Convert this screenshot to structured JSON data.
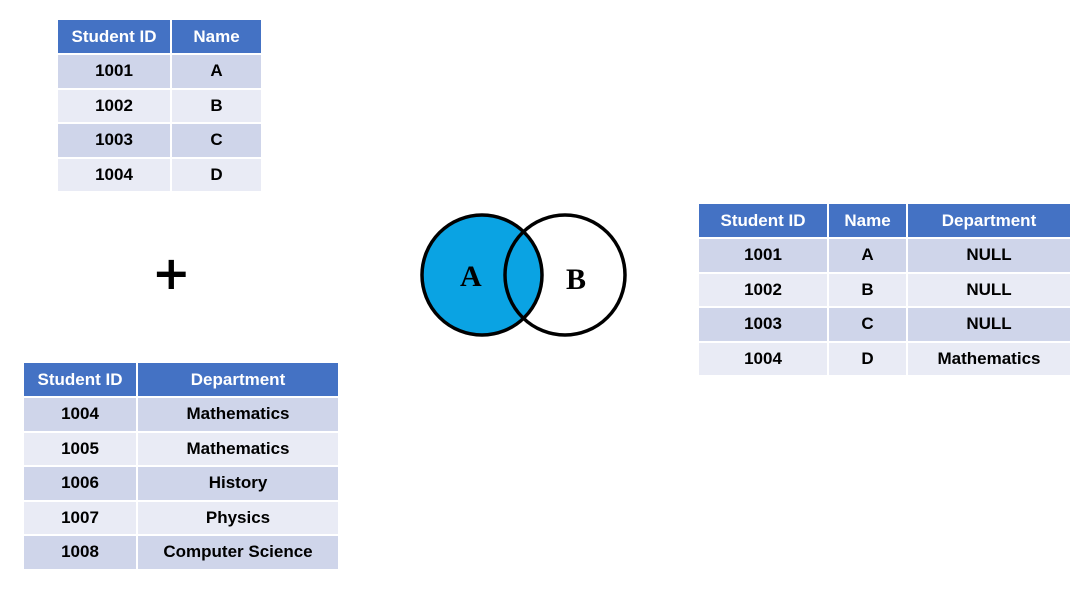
{
  "operator_symbol": "+",
  "students": {
    "columns": [
      "Student ID",
      "Name"
    ],
    "rows": [
      [
        "1001",
        "A"
      ],
      [
        "1002",
        "B"
      ],
      [
        "1003",
        "C"
      ],
      [
        "1004",
        "D"
      ]
    ]
  },
  "departments": {
    "columns": [
      "Student ID",
      "Department"
    ],
    "rows": [
      [
        "1004",
        "Mathematics"
      ],
      [
        "1005",
        "Mathematics"
      ],
      [
        "1006",
        "History"
      ],
      [
        "1007",
        "Physics"
      ],
      [
        "1008",
        "Computer Science"
      ]
    ]
  },
  "venn": {
    "left_label": "A",
    "right_label": "B",
    "highlight_color": "#0aa3e3",
    "highlighted_set": "A"
  },
  "result": {
    "columns": [
      "Student ID",
      "Name",
      "Department"
    ],
    "rows": [
      [
        "1001",
        "A",
        "NULL"
      ],
      [
        "1002",
        "B",
        "NULL"
      ],
      [
        "1003",
        "C",
        "NULL"
      ],
      [
        "1004",
        "D",
        "Mathematics"
      ]
    ]
  },
  "colors": {
    "header_bg": "#4472c4",
    "row_odd": "#cfd5ea",
    "row_even": "#e9ebf5"
  }
}
